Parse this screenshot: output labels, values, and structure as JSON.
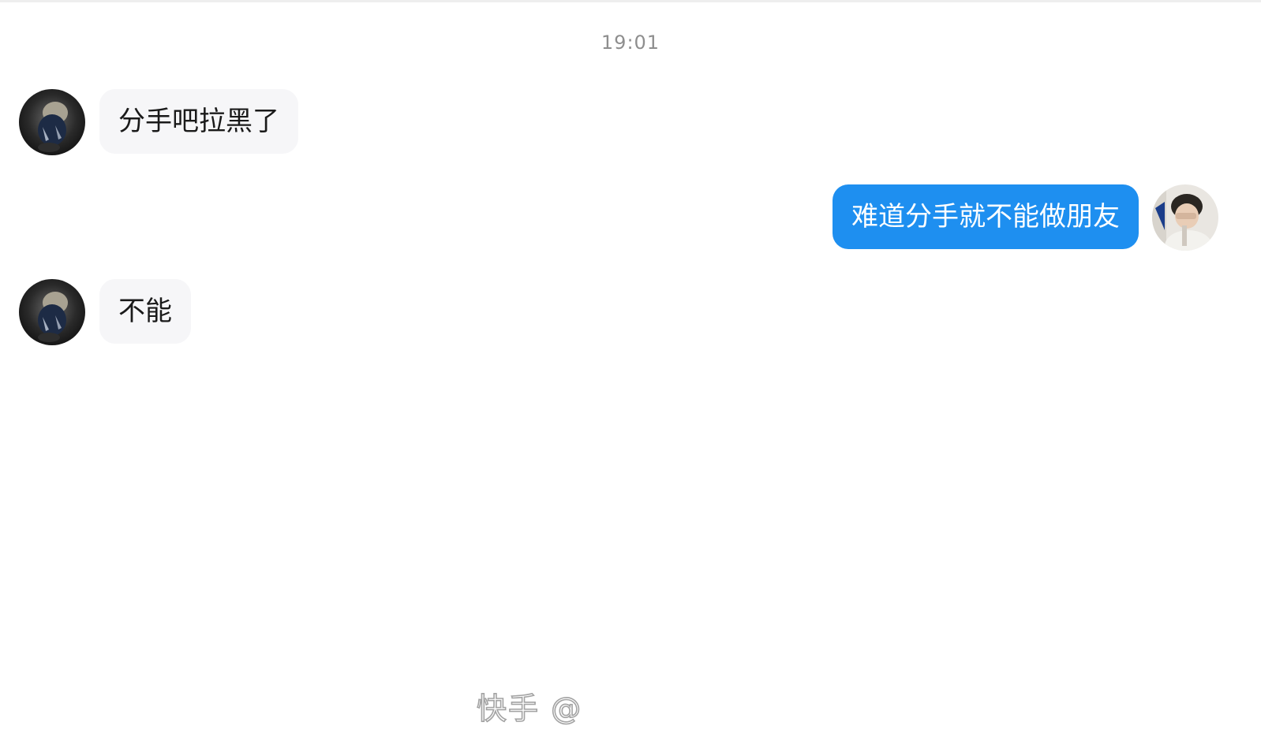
{
  "chat": {
    "timestamp": "19:01",
    "messages": [
      {
        "sender": "contact",
        "text": "分手吧拉黑了"
      },
      {
        "sender": "me",
        "text": "难道分手就不能做朋友"
      },
      {
        "sender": "contact",
        "text": "不能"
      }
    ]
  },
  "watermark": {
    "text": "快手 @"
  },
  "colors": {
    "outgoing_bubble": "#1e8ff0",
    "incoming_bubble": "#f6f6f8",
    "timestamp_text": "#8e8e8e"
  },
  "icons": {
    "contact_avatar": "contact-avatar-photo",
    "my_avatar": "user-avatar-photo"
  }
}
